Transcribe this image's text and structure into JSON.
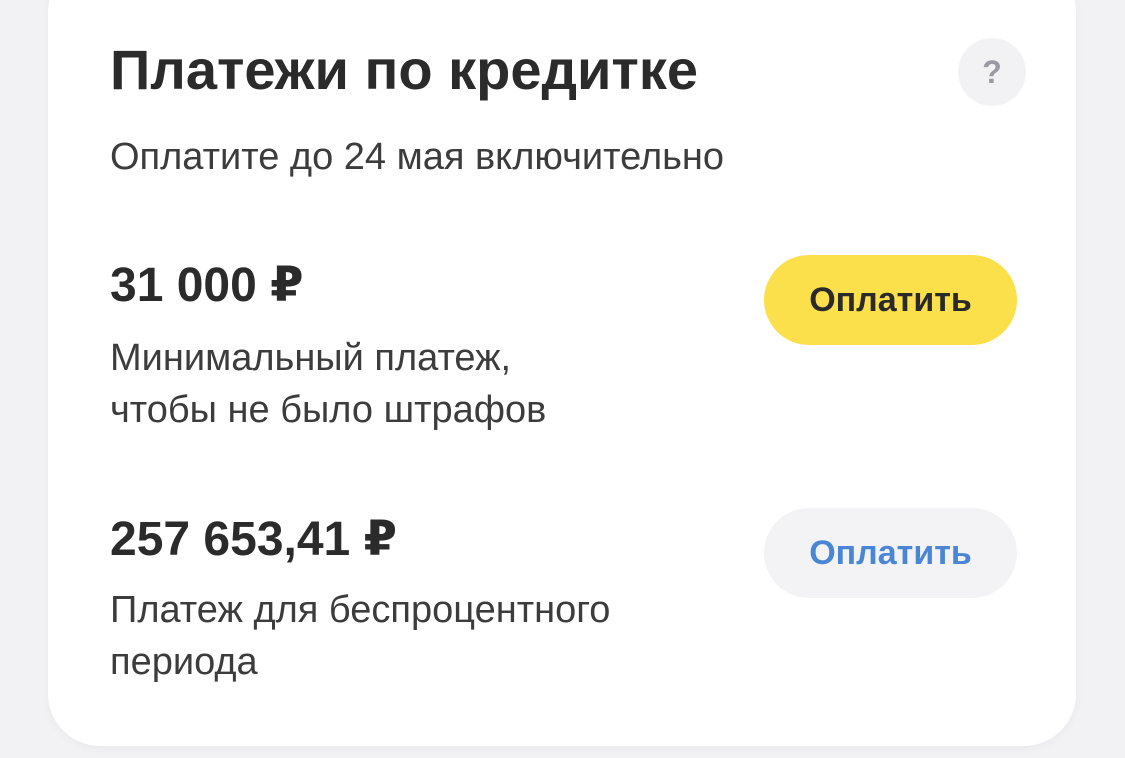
{
  "card": {
    "title": "Платежи по кредитке",
    "help_label": "?",
    "subtitle": "Оплатите до 24 мая включительно"
  },
  "payments": [
    {
      "amount": "31 000 ₽",
      "description_lines": [
        "Минимальный платеж,",
        "чтобы не было штрафов"
      ],
      "button_label": "Оплатить",
      "button_style": "primary"
    },
    {
      "amount": "257 653,41 ₽",
      "description_lines": [
        "Платеж для беспроцентного",
        "периода"
      ],
      "button_label": "Оплатить",
      "button_style": "secondary"
    }
  ],
  "colors": {
    "primary_button": "#fbdf4b",
    "secondary_button_text": "#4a86d6",
    "secondary_button_bg": "#f3f3f5",
    "background": "#f2f2f4",
    "card": "#ffffff"
  },
  "icons": {
    "help": "question-mark-icon"
  }
}
